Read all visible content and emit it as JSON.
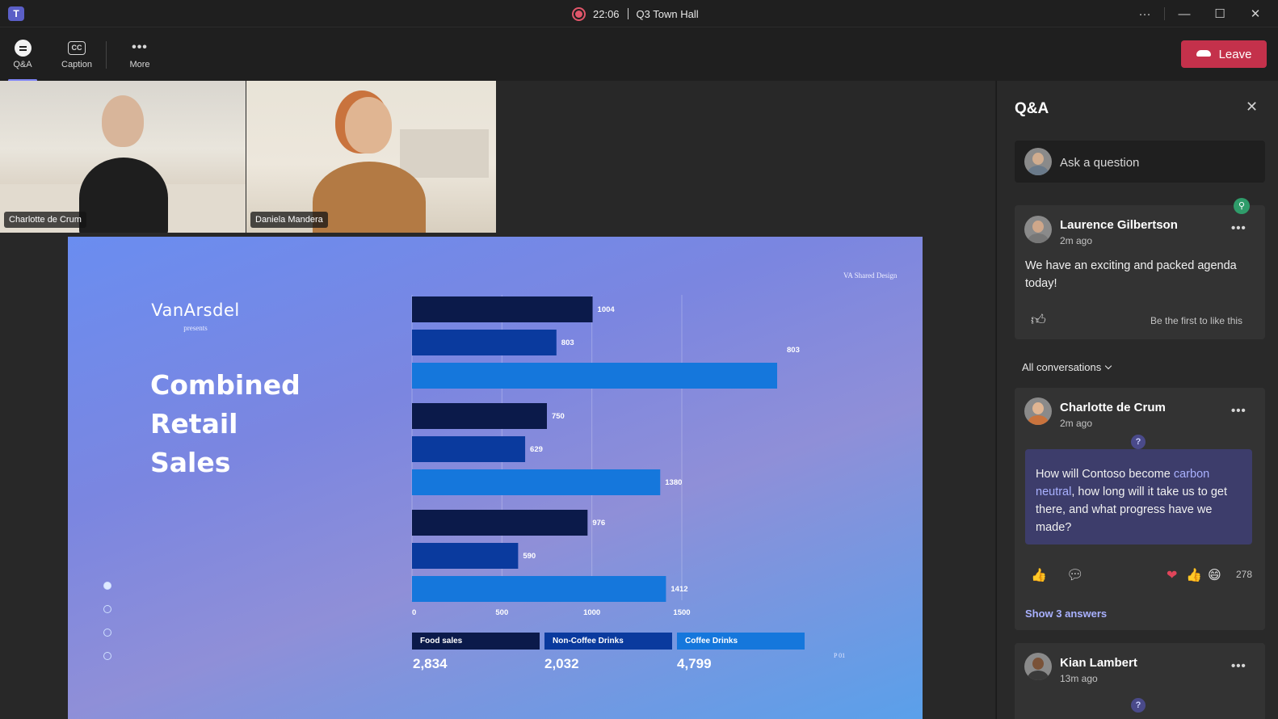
{
  "titlebar": {
    "app_icon": "T",
    "timer": "22:06",
    "meeting_title": "Q3 Town Hall",
    "more": "···",
    "minimize": "—",
    "maximize": "☐",
    "close": "✕"
  },
  "toolbar": {
    "qa_label": "Q&A",
    "caption_label": "Caption",
    "caption_icon": "CC",
    "more_label": "More",
    "more_icon": "•••",
    "leave_label": "Leave"
  },
  "videos": [
    {
      "name": "Charlotte de Crum"
    },
    {
      "name": "Daniela Mandera"
    }
  ],
  "slide": {
    "brand": "VanArsdel",
    "presents": "presents",
    "tag": "VA Shared Design",
    "title_lines": [
      "Combined",
      "Retail",
      "Sales"
    ],
    "page": "P 01"
  },
  "chart_data": {
    "type": "bar",
    "orientation": "horizontal",
    "bars": [
      {
        "series": "Food sales",
        "value": 1004,
        "label": "1004"
      },
      {
        "series": "Non-Coffee Drinks",
        "value": 803,
        "label": "803"
      },
      {
        "series": "Coffee Drinks",
        "value": 2030,
        "label": "803"
      },
      {
        "series": "Food sales",
        "value": 750,
        "label": "750"
      },
      {
        "series": "Non-Coffee Drinks",
        "value": 629,
        "label": "629"
      },
      {
        "series": "Coffee Drinks",
        "value": 1380,
        "label": "1380"
      },
      {
        "series": "Food sales",
        "value": 976,
        "label": "976"
      },
      {
        "series": "Non-Coffee Drinks",
        "value": 590,
        "label": "590"
      },
      {
        "series": "Coffee Drinks",
        "value": 1412,
        "label": "1412"
      }
    ],
    "x_ticks": [
      "0",
      "500",
      "1000",
      "1500"
    ],
    "xlim": [
      0,
      2030
    ],
    "grid": true,
    "legend": [
      {
        "name": "Food sales",
        "total": "2,834",
        "color": "#0b1a4a"
      },
      {
        "name": "Non-Coffee Drinks",
        "total": "2,032",
        "color": "#0a3a9e"
      },
      {
        "name": "Coffee Drinks",
        "total": "4,799",
        "color": "#1577dc"
      }
    ],
    "legend_placement": "bottom"
  },
  "qa": {
    "title": "Q&A",
    "close": "✕",
    "ask_placeholder": "Ask a question",
    "pinned": {
      "author": "Laurence Gilbertson",
      "time": "2m ago",
      "text": "We have an exciting and packed agenda today!",
      "like_prompt": "Be the first to like this",
      "more": "•••"
    },
    "filter_label": "All conversations",
    "questions": [
      {
        "author": "Charlotte de Crum",
        "time": "2m ago",
        "text_before": "How will Contoso become ",
        "text_highlight": "carbon neutral",
        "text_after": ", how long will it take us to get there, and what progress have we made?",
        "reaction_count": "278",
        "show_answers": "Show 3 answers",
        "more": "•••"
      },
      {
        "author": "Kian Lambert",
        "time": "13m ago",
        "more": "•••"
      }
    ]
  }
}
